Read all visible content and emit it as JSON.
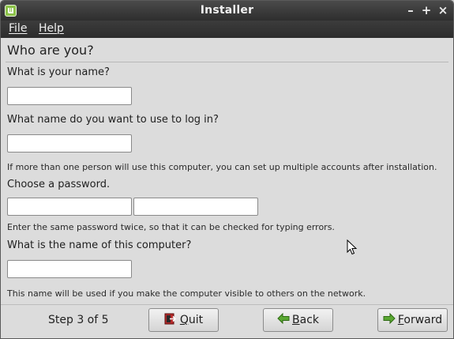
{
  "window": {
    "title": "Installer",
    "controls": {
      "minimize": "–",
      "maximize": "+",
      "close": "×"
    }
  },
  "menu": [
    {
      "accel": "F",
      "rest": "ile"
    },
    {
      "accel": "H",
      "rest": "elp"
    }
  ],
  "page": {
    "heading": "Who are you?",
    "name_label": "What is your name?",
    "name_value": "",
    "login_label": "What name do you want to use to log in?",
    "login_value": "",
    "login_hint": "If more than one person will use this computer, you can set up multiple accounts after installation.",
    "password_label": "Choose a password.",
    "password_value": "",
    "password_confirm_value": "",
    "password_hint": "Enter the same password twice, so that it can be checked for typing errors.",
    "computer_label": "What is the name of this computer?",
    "computer_value": "",
    "computer_hint": "This name will be used if you make the computer visible to others on the network."
  },
  "footer": {
    "step": "Step 3 of 5",
    "quit": {
      "accel": "Q",
      "rest": "uit"
    },
    "back": {
      "accel": "B",
      "rest": "ack"
    },
    "forward": {
      "accel": "F",
      "rest": "orward"
    }
  },
  "colors": {
    "titlebar": "#3a3a3a",
    "window_bg": "#dcdcdc",
    "arrow_green": "#5aa832",
    "quit_red": "#b52a2a"
  }
}
